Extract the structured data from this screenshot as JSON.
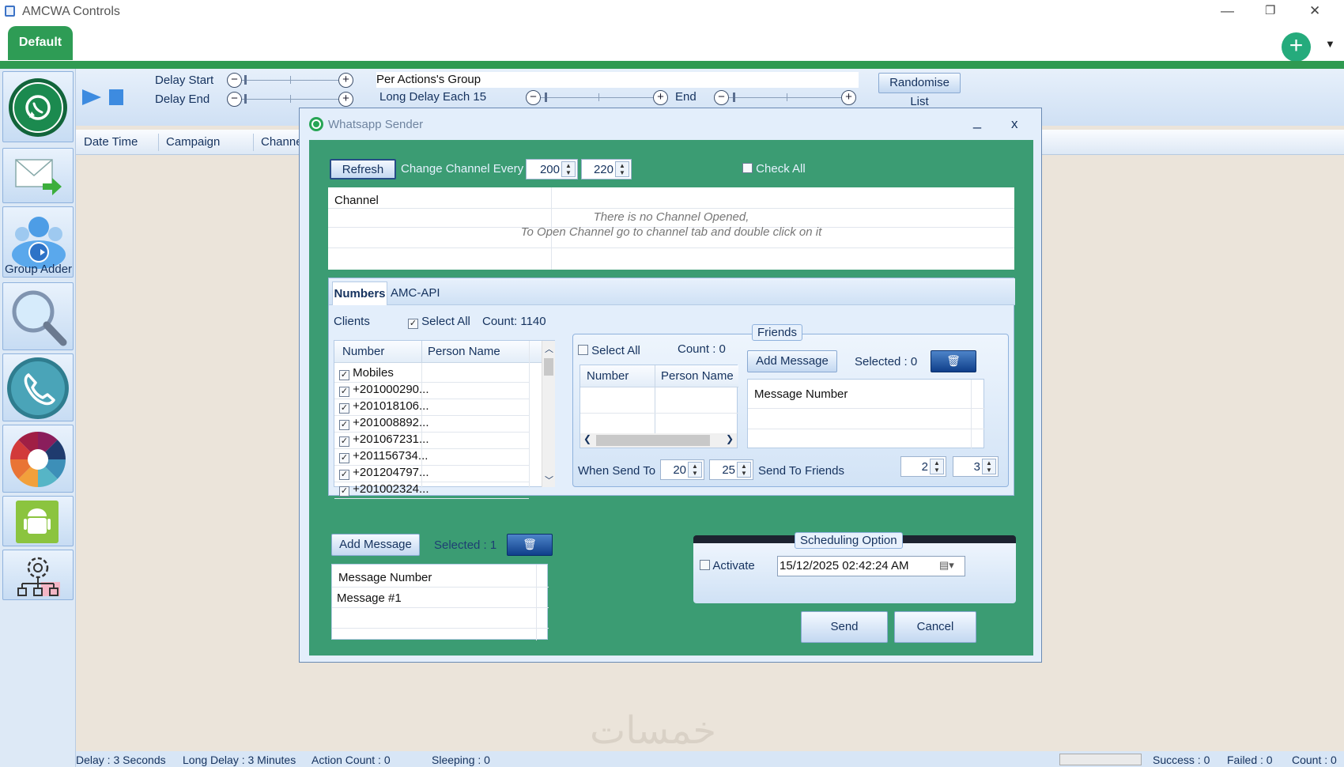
{
  "window": {
    "title": "AMCWA Controls",
    "minimize": "—",
    "restore": "❐",
    "close": "✕"
  },
  "tabs": {
    "default": "Default",
    "add_icon": "plus-icon"
  },
  "sidebar": {
    "group_adder_label": "Group Adder"
  },
  "toolbar": {
    "delay_start": "Delay Start",
    "delay_end": "Delay End",
    "per_actions_group": "Per Actions's Group",
    "long_delay_each": "Long Delay Each 15",
    "end": "End",
    "randomise_list": "Randomise List"
  },
  "columns": {
    "date_time": "Date Time",
    "campaign": "Campaign",
    "channel": "Channel"
  },
  "statusbar": {
    "delay": "Delay : 3 Seconds",
    "long_delay": "Long Delay : 3 Minutes",
    "action_count": "Action Count : 0",
    "sleeping": "Sleeping : 0",
    "success": "Success : 0",
    "failed": "Failed : 0",
    "count": "Count : 0"
  },
  "watermark": "خمسات",
  "dialog": {
    "title": "Whatsapp Sender",
    "minimize": "_",
    "close": "x",
    "refresh": "Refresh",
    "change_channel_every": "Change Channel Every",
    "spin_min": "200",
    "spin_max": "220",
    "check_all": "Check All",
    "channel_header": "Channel",
    "no_channel_line1": "There is no Channel Opened,",
    "no_channel_line2": "To Open Channel go to channel tab and double click on it",
    "tabs": {
      "numbers": "Numbers",
      "amc_api": "AMC-API"
    },
    "clients": {
      "label": "Clients",
      "select_all": "Select All",
      "count": "Count: 1140",
      "col_number": "Number",
      "col_person": "Person Name",
      "rows": [
        "Mobiles",
        "+201000290...",
        "+201018106...",
        "+201008892...",
        "+201067231...",
        "+201156734...",
        "+201204797...",
        "+201002324..."
      ]
    },
    "friends": {
      "legend": "Friends",
      "select_all": "Select All",
      "count": "Count : 0",
      "col_number": "Number",
      "col_person": "Person Name",
      "add_message": "Add Message",
      "selected": "Selected : 0",
      "message_header": "Message Number",
      "when_send_to": "When Send To",
      "when_min": "20",
      "when_max": "25",
      "send_to_friends": "Send To Friends",
      "friends_min": "2",
      "friends_max": "3"
    },
    "messages": {
      "add_message": "Add Message",
      "selected": "Selected : 1",
      "header": "Message Number",
      "rows": [
        "Message #1"
      ]
    },
    "scheduling": {
      "legend": "Scheduling Option",
      "activate": "Activate",
      "datetime": "15/12/2025 02:42:24 AM"
    },
    "send": "Send",
    "cancel": "Cancel"
  }
}
